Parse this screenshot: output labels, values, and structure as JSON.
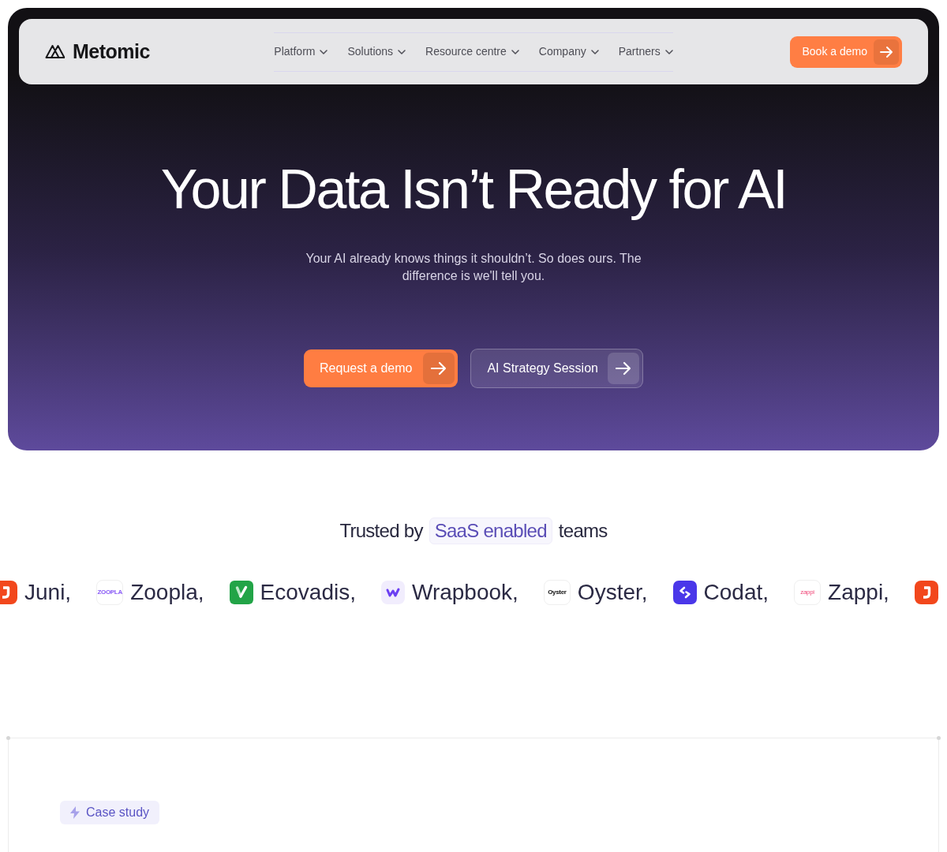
{
  "nav": {
    "brand": "Metomic",
    "menu": [
      {
        "label": "Platform",
        "dropdown": true
      },
      {
        "label": "Solutions",
        "dropdown": true
      },
      {
        "label": "Resource centre",
        "dropdown": true
      },
      {
        "label": "Company",
        "dropdown": true
      },
      {
        "label": "Partners",
        "dropdown": true
      }
    ],
    "cta": "Book a demo"
  },
  "hero": {
    "title": "Your Data Isn’t Ready for AI",
    "subtitle": "Your AI already knows things it shouldn’t. So does ours. The difference is we'll tell you.",
    "buttons": [
      {
        "label": "Request a demo",
        "kind": "primary"
      },
      {
        "label": "AI Strategy Session",
        "kind": "secondary"
      }
    ]
  },
  "trusted": {
    "before": "Trusted by",
    "highlight": "SaaS enabled",
    "after": "teams"
  },
  "logos": [
    {
      "name": "Juni,",
      "kind": "hook"
    },
    {
      "name": "Zoopla,",
      "kind": "violetmark",
      "wordmark": "ZOOPLA"
    },
    {
      "name": "Ecovadis,",
      "kind": "tick"
    },
    {
      "name": "Wrapbook,",
      "kind": "zigzag"
    },
    {
      "name": "Oyster,",
      "kind": "blackmark",
      "wordmark": "Oyster"
    },
    {
      "name": "Codat,",
      "kind": "brackets"
    },
    {
      "name": "Zappi,",
      "kind": "pinkmark",
      "wordmark": "zappi"
    },
    {
      "kind": "hook"
    }
  ],
  "case_study": {
    "tag": "Case study"
  }
}
